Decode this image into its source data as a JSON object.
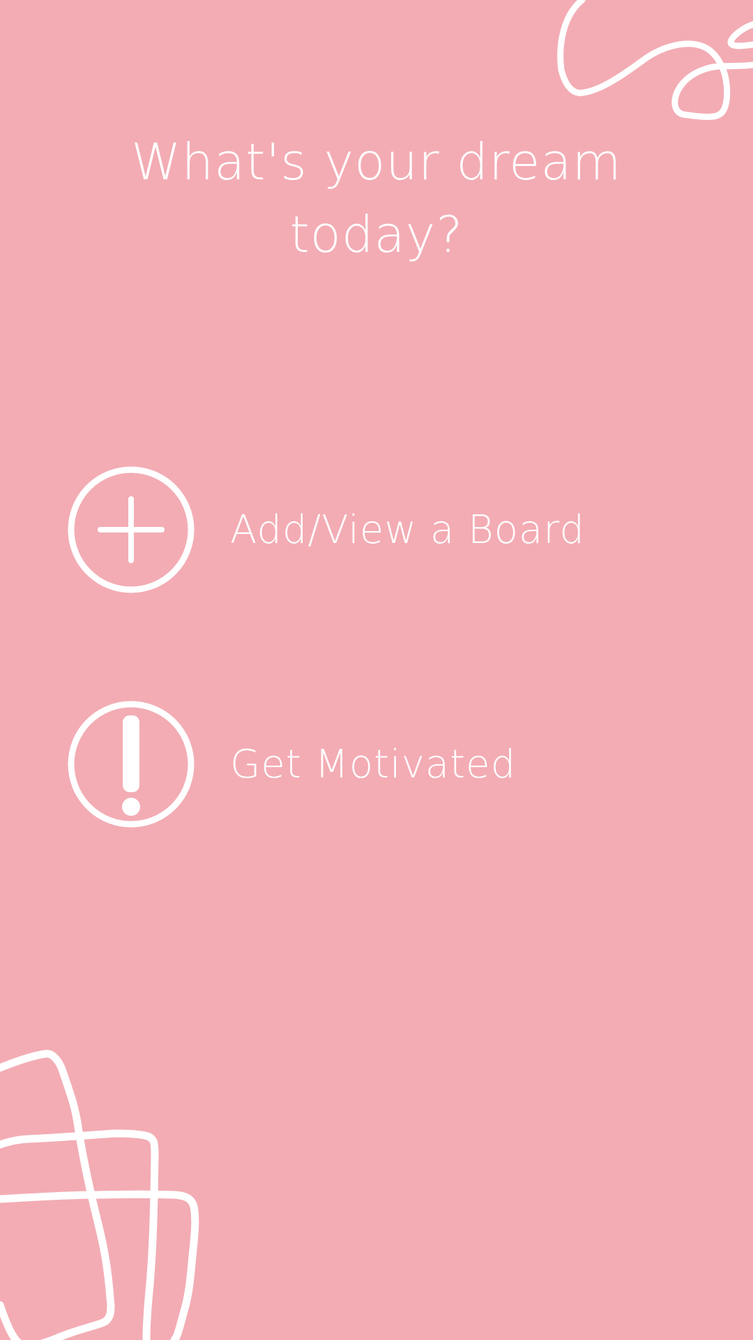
{
  "header": {
    "title": "What's your dream\ntoday?"
  },
  "menu": {
    "items": [
      {
        "label": "Add/View a Board",
        "icon": "plus-circle-icon"
      },
      {
        "label": "Get Motivated",
        "icon": "exclamation-circle-icon"
      }
    ]
  },
  "colors": {
    "background": "#f3acb4",
    "foreground": "#ffffff"
  }
}
